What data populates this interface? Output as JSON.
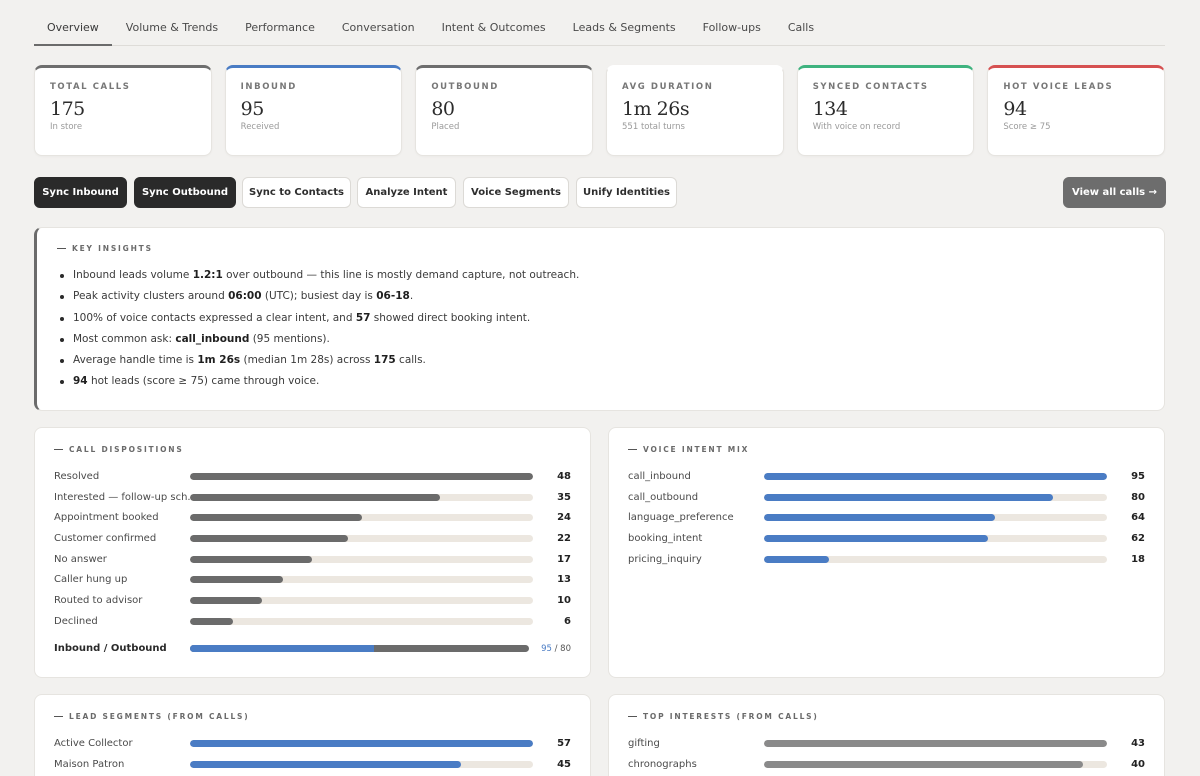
{
  "tabs": [
    {
      "label": "Overview",
      "active": true
    },
    {
      "label": "Volume & Trends"
    },
    {
      "label": "Performance"
    },
    {
      "label": "Conversation"
    },
    {
      "label": "Intent & Outcomes"
    },
    {
      "label": "Leads & Segments"
    },
    {
      "label": "Follow-ups"
    },
    {
      "label": "Calls"
    }
  ],
  "kpis": [
    {
      "label": "Total Calls",
      "value": "175",
      "sub": "In store",
      "accent": "#6e6e6e"
    },
    {
      "label": "Inbound",
      "value": "95",
      "sub": "Received",
      "accent": "#4a7cc4"
    },
    {
      "label": "Outbound",
      "value": "80",
      "sub": "Placed",
      "accent": "#6e6e6e"
    },
    {
      "label": "Avg Duration",
      "value": "1m 26s",
      "sub": "551 total turns",
      "accent": "#ffffff"
    },
    {
      "label": "Synced Contacts",
      "value": "134",
      "sub": "With voice on record",
      "accent": "#3fb37f"
    },
    {
      "label": "Hot Voice Leads",
      "value": "94",
      "sub": "Score ≥ 75",
      "accent": "#d65151"
    }
  ],
  "actions": {
    "sync_inbound": "Sync Inbound",
    "sync_outbound": "Sync Outbound",
    "sync_contacts": "Sync to Contacts",
    "analyze_intent": "Analyze Intent",
    "voice_segments": "Voice Segments",
    "unify_identities": "Unify Identities",
    "view_all": "View all calls →"
  },
  "insights": {
    "title": "Key Insights",
    "items": [
      {
        "parts": [
          [
            "",
            "Inbound leads volume "
          ],
          [
            "b",
            "1.2:1"
          ],
          [
            "",
            " over outbound — this line is mostly demand capture, not outreach."
          ]
        ]
      },
      {
        "parts": [
          [
            "",
            "Peak activity clusters around "
          ],
          [
            "b",
            "06:00"
          ],
          [
            "",
            " (UTC); busiest day is "
          ],
          [
            "b",
            "06-18"
          ],
          [
            "",
            "."
          ]
        ]
      },
      {
        "parts": [
          [
            "",
            "100% of voice contacts expressed a clear intent, and "
          ],
          [
            "b",
            "57"
          ],
          [
            "",
            " showed direct booking intent."
          ]
        ]
      },
      {
        "parts": [
          [
            "",
            "Most common ask: "
          ],
          [
            "b",
            "call_inbound"
          ],
          [
            "",
            " (95 mentions)."
          ]
        ]
      },
      {
        "parts": [
          [
            "",
            "Average handle time is "
          ],
          [
            "b",
            "1m 26s"
          ],
          [
            "",
            " (median 1m 28s) across "
          ],
          [
            "b",
            "175"
          ],
          [
            "",
            " calls."
          ]
        ]
      },
      {
        "parts": [
          [
            "b",
            "94"
          ],
          [
            "",
            " hot leads (score ≥ 75) came through voice."
          ]
        ]
      }
    ]
  },
  "dispositions": {
    "title": "Call Dispositions",
    "max": 48,
    "rows": [
      {
        "name": "Resolved",
        "value": 48
      },
      {
        "name": "Interested — follow-up sch...",
        "value": 35
      },
      {
        "name": "Appointment booked",
        "value": 24
      },
      {
        "name": "Customer confirmed",
        "value": 22
      },
      {
        "name": "No answer",
        "value": 17
      },
      {
        "name": "Caller hung up",
        "value": 13
      },
      {
        "name": "Routed to advisor",
        "value": 10
      },
      {
        "name": "Declined",
        "value": 6
      }
    ],
    "ratio_label": "Inbound / Outbound",
    "inbound": 95,
    "outbound": 80
  },
  "intent_mix": {
    "title": "Voice Intent Mix",
    "max": 95,
    "rows": [
      {
        "name": "call_inbound",
        "value": 95
      },
      {
        "name": "call_outbound",
        "value": 80
      },
      {
        "name": "language_preference",
        "value": 64
      },
      {
        "name": "booking_intent",
        "value": 62
      },
      {
        "name": "pricing_inquiry",
        "value": 18
      }
    ]
  },
  "lead_segments": {
    "title": "Lead Segments (from Calls)",
    "max": 57,
    "rows": [
      {
        "name": "Active Collector",
        "value": 57
      },
      {
        "name": "Maison Patron",
        "value": 45
      }
    ]
  },
  "top_interests": {
    "title": "Top Interests (from Calls)",
    "max": 43,
    "rows": [
      {
        "name": "gifting",
        "value": 43
      },
      {
        "name": "chronographs",
        "value": 40
      }
    ]
  }
}
